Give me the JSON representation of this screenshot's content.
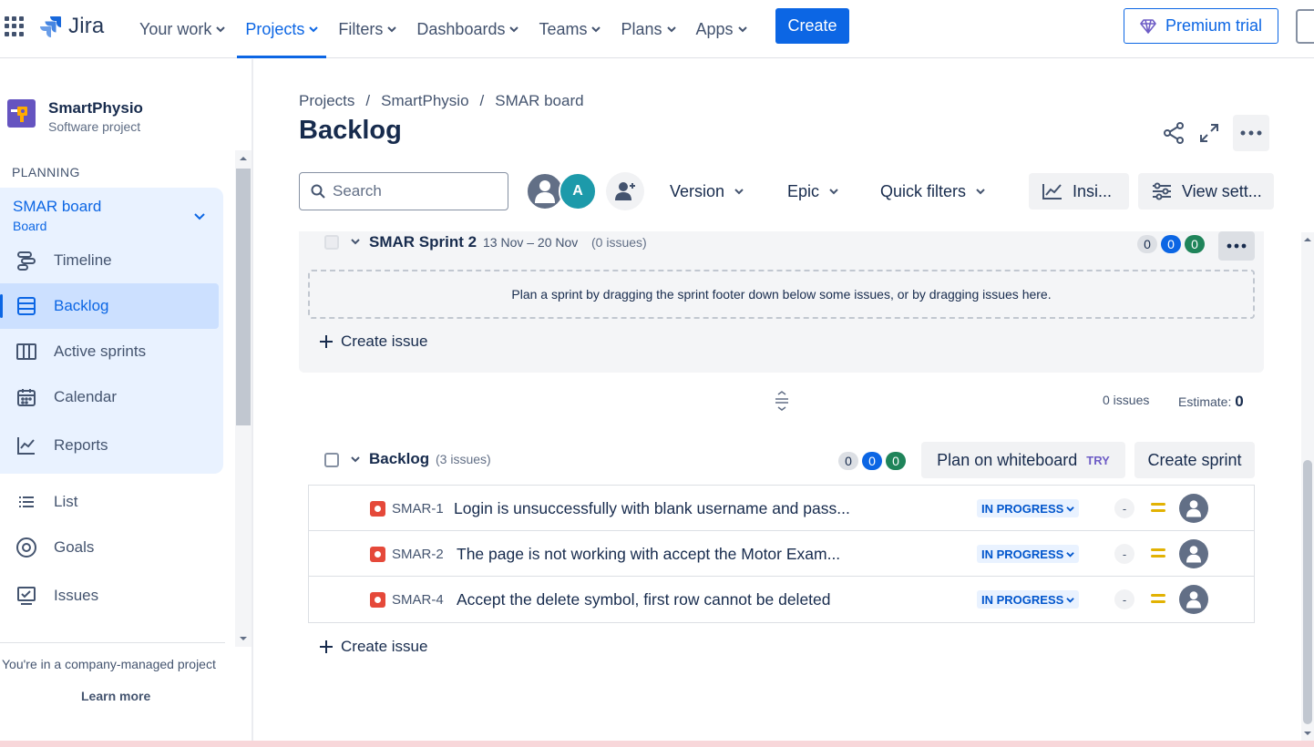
{
  "topnav": {
    "brand": "Jira",
    "items": [
      {
        "label": "Your work",
        "active": false
      },
      {
        "label": "Projects",
        "active": true
      },
      {
        "label": "Filters",
        "active": false
      },
      {
        "label": "Dashboards",
        "active": false
      },
      {
        "label": "Teams",
        "active": false
      },
      {
        "label": "Plans",
        "active": false
      },
      {
        "label": "Apps",
        "active": false
      }
    ],
    "create_label": "Create",
    "premium_label": "Premium trial"
  },
  "sidebar": {
    "project_name": "SmartPhysio",
    "project_type": "Software project",
    "section_label": "PLANNING",
    "board_title": "SMAR board",
    "board_sub": "Board",
    "items": [
      {
        "label": "Timeline",
        "icon": "timeline-icon"
      },
      {
        "label": "Backlog",
        "icon": "backlog-icon",
        "active": true
      },
      {
        "label": "Active sprints",
        "icon": "board-columns-icon"
      },
      {
        "label": "Calendar",
        "icon": "calendar-icon"
      },
      {
        "label": "Reports",
        "icon": "reports-icon"
      },
      {
        "label": "List",
        "icon": "list-icon"
      },
      {
        "label": "Goals",
        "icon": "goals-icon"
      },
      {
        "label": "Issues",
        "icon": "issues-icon"
      }
    ],
    "footer_text": "You're in a company-managed project",
    "footer_link": "Learn more"
  },
  "main": {
    "breadcrumbs": [
      "Projects",
      "SmartPhysio",
      "SMAR board"
    ],
    "title": "Backlog",
    "search_placeholder": "Search",
    "avatar_initial": "A",
    "filters": {
      "version": "Version",
      "epic": "Epic",
      "quick": "Quick filters"
    },
    "insights_label": "Insi...",
    "view_settings_label": "View sett..."
  },
  "sprint": {
    "name": "SMAR Sprint 2",
    "dates": "13 Nov – 20 Nov",
    "count": "(0 issues)",
    "pills": [
      "0",
      "0",
      "0"
    ],
    "drop_hint": "Plan a sprint by dragging the sprint footer down below some issues, or by dragging issues here.",
    "create_issue": "Create issue"
  },
  "summary": {
    "issues": "0 issues",
    "estimate_label": "Estimate:",
    "estimate_value": "0"
  },
  "backlog": {
    "title": "Backlog",
    "count": "(3 issues)",
    "pills": [
      "0",
      "0",
      "0"
    ],
    "plan_whiteboard": "Plan on whiteboard",
    "try_badge": "TRY",
    "create_sprint": "Create sprint",
    "issues": [
      {
        "key": "SMAR-1",
        "summary": "Login is unsuccessfully with blank username and pass...",
        "status": "IN PROGRESS",
        "estimate": "-"
      },
      {
        "key": "SMAR-2",
        "summary": "The page is not working with accept the Motor Exam...",
        "status": "IN PROGRESS",
        "estimate": "-"
      },
      {
        "key": "SMAR-4",
        "summary": "Accept the delete symbol, first row cannot be deleted",
        "status": "IN PROGRESS",
        "estimate": "-"
      }
    ],
    "create_issue": "Create issue"
  },
  "colors": {
    "accent": "#0c66e4",
    "bug": "#e5493a",
    "priority_medium": "#e2b203",
    "done_green": "#1f845a"
  }
}
